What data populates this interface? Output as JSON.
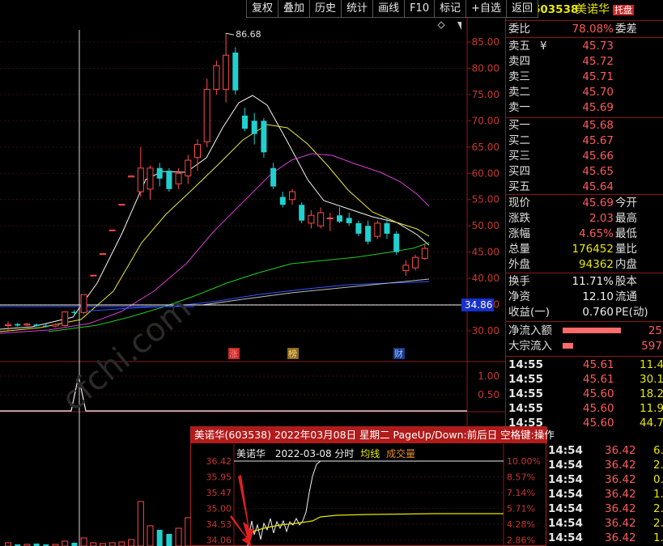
{
  "toolbar": {
    "buttons": [
      "复权",
      "叠加",
      "历史",
      "统计",
      "画线",
      "F10",
      "标记",
      "+自选",
      "返回"
    ]
  },
  "chart": {
    "max_label": "86.68",
    "price_axis": [
      "85.00",
      "80.00",
      "75.00",
      "70.00",
      "65.00",
      "60.00",
      "55.00",
      "50.00",
      "45.00",
      "40.00",
      "35.00",
      "30.00"
    ],
    "current_price_tag": "34.86",
    "markers": {
      "zhang": "涨",
      "bang": "榜",
      "cai": "财"
    },
    "indicator_axis": [
      "1.00",
      "0.50"
    ],
    "candles": [
      {
        "o": 31.0,
        "h": 31.8,
        "l": 30.0,
        "c": 31.2
      },
      {
        "o": 31.3,
        "h": 31.5,
        "l": 30.8,
        "c": 31.0
      },
      {
        "o": 31.1,
        "h": 31.5,
        "l": 30.9,
        "c": 31.3
      },
      {
        "o": 31.2,
        "h": 31.4,
        "l": 30.8,
        "c": 30.9
      },
      {
        "o": 31.0,
        "h": 31.3,
        "l": 30.6,
        "c": 30.8
      },
      {
        "o": 30.9,
        "h": 31.4,
        "l": 30.7,
        "c": 31.2
      },
      {
        "o": 31.0,
        "h": 33.7,
        "l": 30.8,
        "c": 33.6
      },
      {
        "o": 33.6,
        "h": 34.0,
        "l": 32.9,
        "c": 33.4
      },
      {
        "o": 33.5,
        "h": 36.9,
        "l": 33.2,
        "c": 36.9
      },
      {
        "o": 40.5,
        "h": 40.6,
        "l": 40.4,
        "c": 40.6
      },
      {
        "o": 44.6,
        "h": 44.7,
        "l": 44.5,
        "c": 44.7
      },
      {
        "o": 49.1,
        "h": 49.2,
        "l": 49.0,
        "c": 49.2
      },
      {
        "o": 54.0,
        "h": 54.1,
        "l": 53.9,
        "c": 54.1
      },
      {
        "o": 59.3,
        "h": 59.5,
        "l": 59.2,
        "c": 59.5
      },
      {
        "o": 56.5,
        "h": 65.0,
        "l": 55.5,
        "c": 61.0
      },
      {
        "o": 57.0,
        "h": 61.5,
        "l": 55.0,
        "c": 61.0
      },
      {
        "o": 61.0,
        "h": 62.0,
        "l": 57.5,
        "c": 59.0
      },
      {
        "o": 60.5,
        "h": 61.0,
        "l": 56.5,
        "c": 57.0
      },
      {
        "o": 58.0,
        "h": 61.0,
        "l": 57.0,
        "c": 60.0
      },
      {
        "o": 59.5,
        "h": 63.5,
        "l": 58.0,
        "c": 62.5
      },
      {
        "o": 63.0,
        "h": 66.5,
        "l": 60.5,
        "c": 65.5
      },
      {
        "o": 66.0,
        "h": 78.0,
        "l": 65.0,
        "c": 76.0
      },
      {
        "o": 76.0,
        "h": 81.5,
        "l": 75.0,
        "c": 80.5
      },
      {
        "o": 76.0,
        "h": 86.7,
        "l": 73.5,
        "c": 82.5
      },
      {
        "o": 83.0,
        "h": 84.0,
        "l": 75.0,
        "c": 75.8
      },
      {
        "o": 71.0,
        "h": 72.5,
        "l": 68.0,
        "c": 68.5
      },
      {
        "o": 70.0,
        "h": 71.5,
        "l": 65.5,
        "c": 67.5
      },
      {
        "o": 70.0,
        "h": 70.5,
        "l": 63.0,
        "c": 64.0
      },
      {
        "o": 61.0,
        "h": 62.0,
        "l": 57.0,
        "c": 57.5
      },
      {
        "o": 55.5,
        "h": 56.5,
        "l": 53.5,
        "c": 54.0
      },
      {
        "o": 55.0,
        "h": 57.0,
        "l": 54.0,
        "c": 56.5
      },
      {
        "o": 54.0,
        "h": 54.5,
        "l": 50.5,
        "c": 51.0
      },
      {
        "o": 50.5,
        "h": 53.0,
        "l": 49.5,
        "c": 52.0
      },
      {
        "o": 50.0,
        "h": 53.5,
        "l": 49.5,
        "c": 52.5
      },
      {
        "o": 51.5,
        "h": 52.5,
        "l": 49.0,
        "c": 51.5
      },
      {
        "o": 52.0,
        "h": 53.5,
        "l": 50.5,
        "c": 50.8
      },
      {
        "o": 51.5,
        "h": 52.5,
        "l": 50.0,
        "c": 50.5
      },
      {
        "o": 50.5,
        "h": 51.0,
        "l": 48.0,
        "c": 48.5
      },
      {
        "o": 50.0,
        "h": 51.0,
        "l": 46.5,
        "c": 47.0
      },
      {
        "o": 48.0,
        "h": 51.0,
        "l": 47.5,
        "c": 50.5
      },
      {
        "o": 50.5,
        "h": 51.5,
        "l": 47.5,
        "c": 48.5
      },
      {
        "o": 48.5,
        "h": 49.0,
        "l": 44.5,
        "c": 45.0
      },
      {
        "o": 41.5,
        "h": 43.5,
        "l": 40.5,
        "c": 42.5
      },
      {
        "o": 42.0,
        "h": 44.5,
        "l": 41.5,
        "c": 44.0
      },
      {
        "o": 43.8,
        "h": 46.5,
        "l": 43.5,
        "c": 45.69
      }
    ]
  },
  "quote": {
    "marker": "L",
    "code": "603538",
    "name": "美诺华",
    "badge": "托盘",
    "weibi_label": "委比",
    "weibi_value": "78.08%",
    "weicha_label": "委差",
    "sell": [
      {
        "label": "卖五",
        "mark": "¥",
        "price": "45.73"
      },
      {
        "label": "卖四",
        "price": "45.72"
      },
      {
        "label": "卖三",
        "price": "45.71"
      },
      {
        "label": "卖二",
        "price": "45.70"
      },
      {
        "label": "卖一",
        "price": "45.69"
      }
    ],
    "buy": [
      {
        "label": "买一",
        "price": "45.68"
      },
      {
        "label": "买二",
        "price": "45.67"
      },
      {
        "label": "买三",
        "price": "45.66"
      },
      {
        "label": "买四",
        "price": "45.65"
      },
      {
        "label": "买五",
        "price": "45.64"
      }
    ],
    "stats1": [
      {
        "label": "现价",
        "value": "45.69",
        "label2": "今开"
      },
      {
        "label": "涨跌",
        "value": "2.03",
        "label2": "最高"
      },
      {
        "label": "涨幅",
        "value": "4.65%",
        "label2": "最低"
      },
      {
        "label": "总量",
        "value": "176452",
        "label2": "量比"
      },
      {
        "label": "外盘",
        "value": "94362",
        "label2": "内盘"
      }
    ],
    "stats2": [
      {
        "label": "换手",
        "value": "11.71%",
        "label2": "股本"
      },
      {
        "label": "净资",
        "value": "12.10",
        "label2": "流通"
      },
      {
        "label": "收益(一)",
        "value": "0.760",
        "label2": "PE(动)"
      }
    ],
    "flow": [
      {
        "label": "净流入额",
        "value": "25",
        "fill": 0.55
      },
      {
        "label": "大宗流入",
        "value": "597",
        "fill": 0.1
      }
    ]
  },
  "ticks": [
    {
      "time": "14:55",
      "price": "45.61",
      "vol": "11.4"
    },
    {
      "time": "14:55",
      "price": "45.61",
      "vol": "30.1"
    },
    {
      "time": "14:55",
      "price": "45.60",
      "vol": "18.2"
    },
    {
      "time": "14:55",
      "price": "45.60",
      "vol": "11.9"
    },
    {
      "time": "14:55",
      "price": "45.60",
      "vol": "44.7"
    }
  ],
  "popup": {
    "title": "美诺华(603538)  2022年03月08日  星期二  PageUp/Down:前后日  空格键:操作",
    "name": "美诺华",
    "date": "2022-03-08 分时",
    "avg_label": "均线",
    "vol_label": "成交量",
    "left_axis": [
      "36.42",
      "35.95",
      "35.47",
      "35.00",
      "34.53",
      "34.06"
    ],
    "right_axis": [
      "10.00%",
      "8.57%",
      "7.14%",
      "5.71%",
      "4.28%",
      "2.86%"
    ]
  },
  "mini_ticks": [
    {
      "time": "14:54",
      "price": "36.42",
      "vol": "6."
    },
    {
      "time": "14:54",
      "price": "36.42",
      "vol": "2."
    },
    {
      "time": "14:54",
      "price": "36.42",
      "vol": "0."
    },
    {
      "time": "14:54",
      "price": "36.42",
      "vol": "1."
    },
    {
      "time": "14:54",
      "price": "36.42",
      "vol": "2."
    },
    {
      "time": "14:54",
      "price": "36.42",
      "vol": "2."
    },
    {
      "time": "14:54",
      "price": "36.42",
      "vol": "1."
    }
  ],
  "watermark": "cfchi.com"
}
